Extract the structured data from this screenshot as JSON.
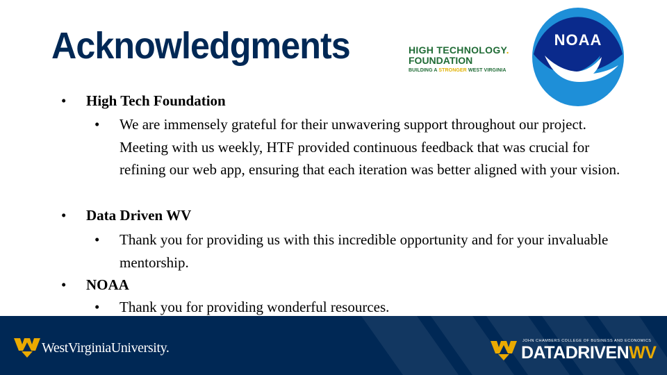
{
  "slide": {
    "title": "Acknowledgments"
  },
  "logos": {
    "htf": {
      "line1": "HIGH TECHNOLOGY",
      "line1_mark": ".",
      "line2": "FOUNDATION",
      "tagline_start": "BUILDING A ",
      "tagline_highlight": "STRONGER",
      "tagline_end": " WEST VIRGINIA"
    },
    "noaa": {
      "label": "NOAA"
    },
    "wvu": {
      "name": "WestVirginiaUniversity."
    },
    "datadrivenwv": {
      "college": "JOHN CHAMBERS COLLEGE OF BUSINESS AND ECONOMICS",
      "name_part1": "DATADRIVEN",
      "name_part2": "WV"
    }
  },
  "content": {
    "sections": [
      {
        "heading": "High Tech Foundation",
        "items": [
          "We are immensely grateful for their unwavering support throughout our project. Meeting with us weekly, HTF provided continuous feedback that was crucial for refining our web app, ensuring that each iteration was better aligned with your vision."
        ]
      },
      {
        "heading": "Data Driven WV",
        "items": [
          "Thank you for providing us with this incredible opportunity and for your invaluable mentorship."
        ]
      },
      {
        "heading": "NOAA",
        "items": [
          "Thank you for providing wonderful resources."
        ]
      }
    ],
    "bullet_level1": "•",
    "bullet_level2": "•"
  },
  "colors": {
    "title": "#002855",
    "footer": "#002855",
    "wvu_gold": "#EAAA00",
    "noaa_blue": "#1E8FD8",
    "noaa_navy": "#0A2A8C",
    "htf_green": "#1F6B35"
  }
}
